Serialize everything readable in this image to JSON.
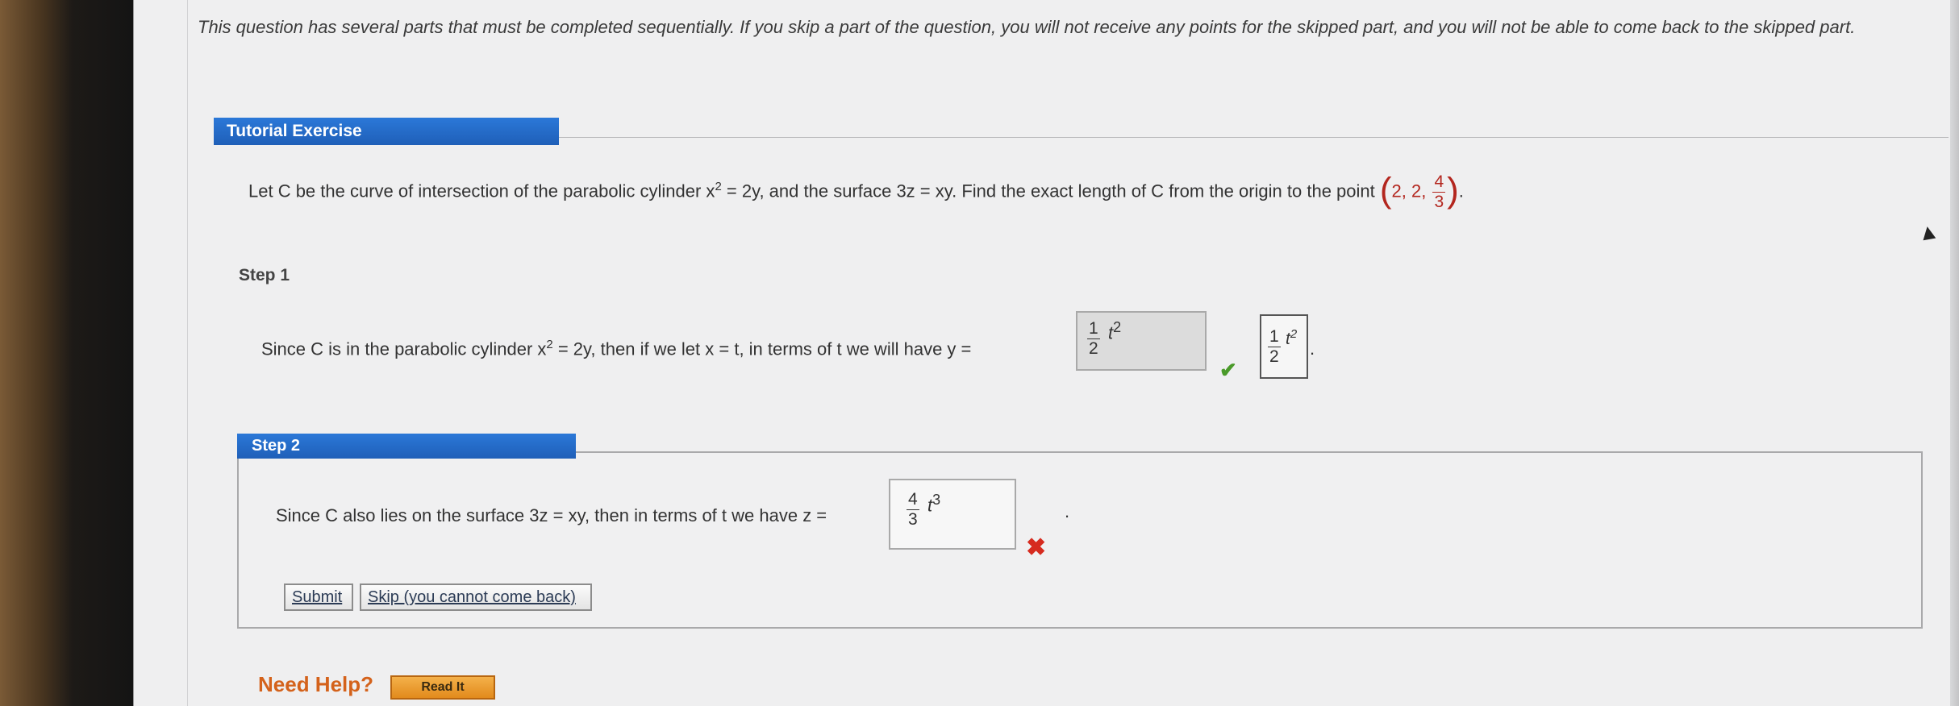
{
  "intro": "This question has several parts that must be completed sequentially. If you skip a part of the question, you will not receive any points for the skipped part, and you will not be able to come back to the skipped part.",
  "tutorial": {
    "title": "Tutorial Exercise"
  },
  "problem": {
    "text_a": "Let C be the curve of intersection of the parabolic cylinder x",
    "exp": "2",
    "text_b": " = 2y, and the surface 3z = xy. Find the exact length of C from the origin to the point ",
    "point_lparen": "(",
    "point_coords": "2, 2, ",
    "point_num": "4",
    "point_den": "3",
    "point_rparen": ")",
    "end": "."
  },
  "step1": {
    "label": "Step 1",
    "text_a": "Since C is in the parabolic cylinder x",
    "exp": "2",
    "text_b": " = 2y, then if we let x = t, in terms of t we will have y =",
    "answer": {
      "num": "1",
      "den": "2",
      "var": "t",
      "exp": "2"
    },
    "correct": {
      "num": "1",
      "den": "2",
      "var": "t",
      "exp": "2"
    },
    "check": "✔",
    "end": "."
  },
  "step2": {
    "label": "Step 2",
    "text": "Since C also lies on the surface 3z = xy, then in terms of t we have z =",
    "answer": {
      "num": "4",
      "den": "3",
      "var": "t",
      "exp": "3"
    },
    "wrong": "✖",
    "end": ".",
    "submit": "Submit",
    "skip": "Skip (you cannot come back)"
  },
  "help": {
    "label": "Need Help?",
    "read": "Read It"
  }
}
